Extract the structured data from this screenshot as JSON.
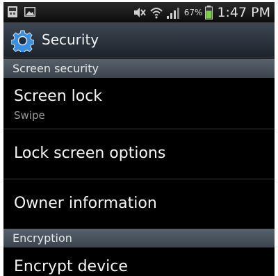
{
  "status_bar": {
    "notification_icons": [
      "sim-card-icon",
      "picture-icon"
    ],
    "status_icons": [
      "mute-icon",
      "wifi-icon",
      "signal-icon",
      "battery-icon"
    ],
    "battery_percent": "67%",
    "time": "1:47 PM",
    "battery_color": "#7fd13b"
  },
  "title_bar": {
    "icon": "settings-gear-icon",
    "title": "Security",
    "icon_color": "#3b8fe0"
  },
  "sections": {
    "screen_security": "Screen security",
    "encryption": "Encryption"
  },
  "items": {
    "screen_lock": {
      "title": "Screen lock",
      "subtitle": "Swipe"
    },
    "lock_screen_options": {
      "title": "Lock screen options"
    },
    "owner_information": {
      "title": "Owner information"
    },
    "encrypt_device": {
      "title": "Encrypt device"
    }
  }
}
